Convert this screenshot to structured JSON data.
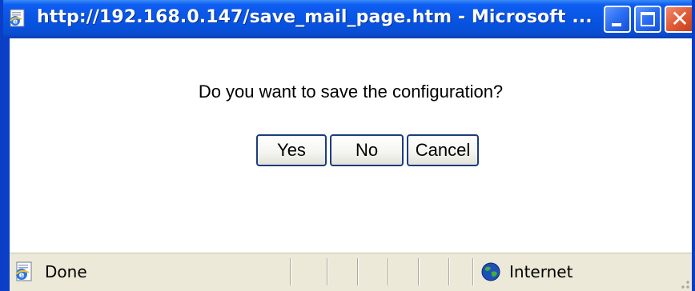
{
  "window": {
    "title": "http://192.168.0.147/save_mail_page.htm - Microsoft ...",
    "title_icon": "ie-page-icon",
    "controls": {
      "minimize_icon": "minimize-icon",
      "maximize_icon": "maximize-icon",
      "close_icon": "close-icon",
      "close_glyph": "✕"
    }
  },
  "dialog": {
    "question": "Do you want to save the configuration?",
    "buttons": {
      "yes": "Yes",
      "no": "No",
      "cancel": "Cancel"
    }
  },
  "statusbar": {
    "page_icon": "ie-page-icon",
    "status": "Done",
    "zone_icon": "globe-icon",
    "zone": "Internet"
  },
  "colors": {
    "titlebar": "#0a56e6",
    "close_button": "#e15a35",
    "statusbar": "#ece9d8",
    "button_border": "#1d3c7d"
  }
}
